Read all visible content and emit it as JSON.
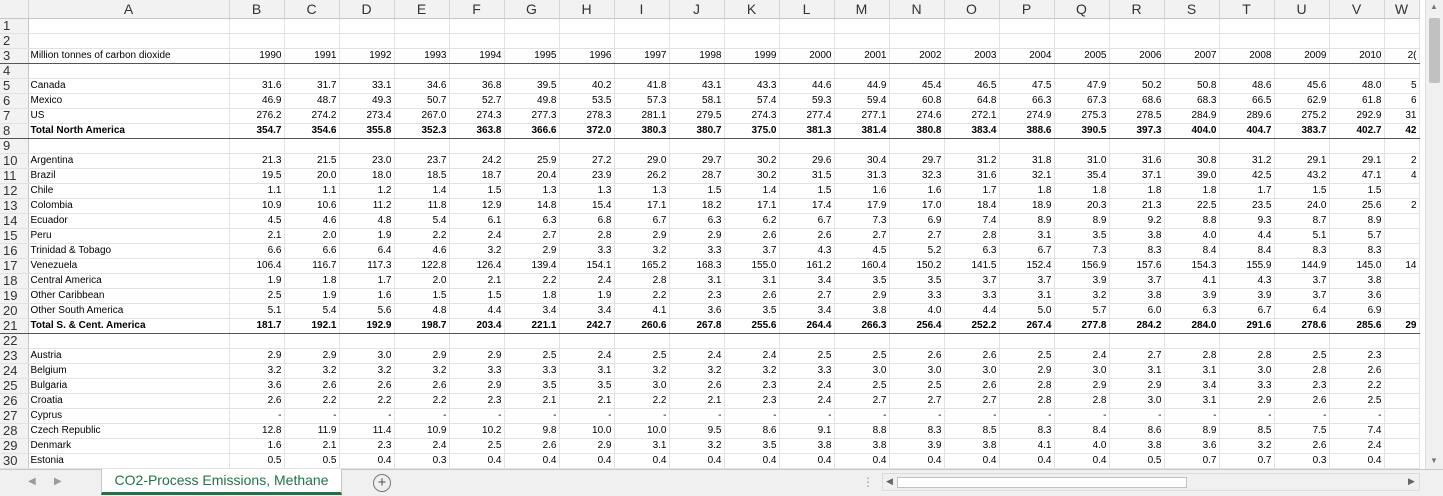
{
  "columns": [
    "A",
    "B",
    "C",
    "D",
    "E",
    "F",
    "G",
    "H",
    "I",
    "J",
    "K",
    "L",
    "M",
    "N",
    "O",
    "P",
    "Q",
    "R",
    "S",
    "T",
    "U",
    "V",
    "W"
  ],
  "rows": [
    {
      "n": "1",
      "kind": "blank",
      "label": "",
      "values": []
    },
    {
      "n": "2",
      "kind": "blank",
      "label": "",
      "values": []
    },
    {
      "n": "3",
      "kind": "hdr",
      "label": "Million tonnes of carbon dioxide",
      "values": [
        "1990",
        "1991",
        "1992",
        "1993",
        "1994",
        "1995",
        "1996",
        "1997",
        "1998",
        "1999",
        "2000",
        "2001",
        "2002",
        "2003",
        "2004",
        "2005",
        "2006",
        "2007",
        "2008",
        "2009",
        "2010",
        "2("
      ]
    },
    {
      "n": "4",
      "kind": "blank",
      "label": "",
      "values": []
    },
    {
      "n": "5",
      "kind": "data",
      "label": "Canada",
      "values": [
        "31.6",
        "31.7",
        "33.1",
        "34.6",
        "36.8",
        "39.5",
        "40.2",
        "41.8",
        "43.1",
        "43.3",
        "44.6",
        "44.9",
        "45.4",
        "46.5",
        "47.5",
        "47.9",
        "50.2",
        "50.8",
        "48.6",
        "45.6",
        "48.0",
        "5"
      ]
    },
    {
      "n": "6",
      "kind": "data",
      "label": "Mexico",
      "values": [
        "46.9",
        "48.7",
        "49.3",
        "50.7",
        "52.7",
        "49.8",
        "53.5",
        "57.3",
        "58.1",
        "57.4",
        "59.3",
        "59.4",
        "60.8",
        "64.8",
        "66.3",
        "67.3",
        "68.6",
        "68.3",
        "66.5",
        "62.9",
        "61.8",
        "6"
      ]
    },
    {
      "n": "7",
      "kind": "data",
      "label": "US",
      "values": [
        "276.2",
        "274.2",
        "273.4",
        "267.0",
        "274.3",
        "277.3",
        "278.3",
        "281.1",
        "279.5",
        "274.3",
        "277.4",
        "277.1",
        "274.6",
        "272.1",
        "274.9",
        "275.3",
        "278.5",
        "284.9",
        "289.6",
        "275.2",
        "292.9",
        "31"
      ]
    },
    {
      "n": "8",
      "kind": "total",
      "label": "Total North America",
      "values": [
        "354.7",
        "354.6",
        "355.8",
        "352.3",
        "363.8",
        "366.6",
        "372.0",
        "380.3",
        "380.7",
        "375.0",
        "381.3",
        "381.4",
        "380.8",
        "383.4",
        "388.6",
        "390.5",
        "397.3",
        "404.0",
        "404.7",
        "383.7",
        "402.7",
        "42"
      ]
    },
    {
      "n": "9",
      "kind": "blank",
      "label": "",
      "values": []
    },
    {
      "n": "10",
      "kind": "data",
      "label": "Argentina",
      "values": [
        "21.3",
        "21.5",
        "23.0",
        "23.7",
        "24.2",
        "25.9",
        "27.2",
        "29.0",
        "29.7",
        "30.2",
        "29.6",
        "30.4",
        "29.7",
        "31.2",
        "31.8",
        "31.0",
        "31.6",
        "30.8",
        "31.2",
        "29.1",
        "29.1",
        "2"
      ]
    },
    {
      "n": "11",
      "kind": "data",
      "label": "Brazil",
      "values": [
        "19.5",
        "20.0",
        "18.0",
        "18.5",
        "18.7",
        "20.4",
        "23.9",
        "26.2",
        "28.7",
        "30.2",
        "31.5",
        "31.3",
        "32.3",
        "31.6",
        "32.1",
        "35.4",
        "37.1",
        "39.0",
        "42.5",
        "43.2",
        "47.1",
        "4"
      ]
    },
    {
      "n": "12",
      "kind": "data",
      "label": "Chile",
      "values": [
        "1.1",
        "1.1",
        "1.2",
        "1.4",
        "1.5",
        "1.3",
        "1.3",
        "1.3",
        "1.5",
        "1.4",
        "1.5",
        "1.6",
        "1.6",
        "1.7",
        "1.8",
        "1.8",
        "1.8",
        "1.8",
        "1.7",
        "1.5",
        "1.5",
        ""
      ]
    },
    {
      "n": "13",
      "kind": "data",
      "label": "Colombia",
      "values": [
        "10.9",
        "10.6",
        "11.2",
        "11.8",
        "12.9",
        "14.8",
        "15.4",
        "17.1",
        "18.2",
        "17.1",
        "17.4",
        "17.9",
        "17.0",
        "18.4",
        "18.9",
        "20.3",
        "21.3",
        "22.5",
        "23.5",
        "24.0",
        "25.6",
        "2"
      ]
    },
    {
      "n": "14",
      "kind": "data",
      "label": "Ecuador",
      "values": [
        "4.5",
        "4.6",
        "4.8",
        "5.4",
        "6.1",
        "6.3",
        "6.8",
        "6.7",
        "6.3",
        "6.2",
        "6.7",
        "7.3",
        "6.9",
        "7.4",
        "8.9",
        "8.9",
        "9.2",
        "8.8",
        "9.3",
        "8.7",
        "8.9",
        ""
      ]
    },
    {
      "n": "15",
      "kind": "data",
      "label": "Peru",
      "values": [
        "2.1",
        "2.0",
        "1.9",
        "2.2",
        "2.4",
        "2.7",
        "2.8",
        "2.9",
        "2.9",
        "2.6",
        "2.6",
        "2.7",
        "2.7",
        "2.8",
        "3.1",
        "3.5",
        "3.8",
        "4.0",
        "4.4",
        "5.1",
        "5.7",
        ""
      ]
    },
    {
      "n": "16",
      "kind": "data",
      "label": "Trinidad & Tobago",
      "values": [
        "6.6",
        "6.6",
        "6.4",
        "4.6",
        "3.2",
        "2.9",
        "3.3",
        "3.2",
        "3.3",
        "3.7",
        "4.3",
        "4.5",
        "5.2",
        "6.3",
        "6.7",
        "7.3",
        "8.3",
        "8.4",
        "8.4",
        "8.3",
        "8.3",
        ""
      ]
    },
    {
      "n": "17",
      "kind": "data",
      "label": "Venezuela",
      "values": [
        "106.4",
        "116.7",
        "117.3",
        "122.8",
        "126.4",
        "139.4",
        "154.1",
        "165.2",
        "168.3",
        "155.0",
        "161.2",
        "160.4",
        "150.2",
        "141.5",
        "152.4",
        "156.9",
        "157.6",
        "154.3",
        "155.9",
        "144.9",
        "145.0",
        "14"
      ]
    },
    {
      "n": "18",
      "kind": "data",
      "label": "Central America",
      "values": [
        "1.9",
        "1.8",
        "1.7",
        "2.0",
        "2.1",
        "2.2",
        "2.4",
        "2.8",
        "3.1",
        "3.1",
        "3.4",
        "3.5",
        "3.5",
        "3.7",
        "3.7",
        "3.9",
        "3.7",
        "4.1",
        "4.3",
        "3.7",
        "3.8",
        ""
      ]
    },
    {
      "n": "19",
      "kind": "data",
      "label": "Other Caribbean",
      "values": [
        "2.5",
        "1.9",
        "1.6",
        "1.5",
        "1.5",
        "1.8",
        "1.9",
        "2.2",
        "2.3",
        "2.6",
        "2.7",
        "2.9",
        "3.3",
        "3.3",
        "3.1",
        "3.2",
        "3.8",
        "3.9",
        "3.9",
        "3.7",
        "3.6",
        ""
      ]
    },
    {
      "n": "20",
      "kind": "data",
      "label": "Other South America",
      "values": [
        "5.1",
        "5.4",
        "5.6",
        "4.8",
        "4.4",
        "3.4",
        "3.4",
        "4.1",
        "3.6",
        "3.5",
        "3.4",
        "3.8",
        "4.0",
        "4.4",
        "5.0",
        "5.7",
        "6.0",
        "6.3",
        "6.7",
        "6.4",
        "6.9",
        ""
      ]
    },
    {
      "n": "21",
      "kind": "total",
      "label": "Total S. & Cent. America",
      "values": [
        "181.7",
        "192.1",
        "192.9",
        "198.7",
        "203.4",
        "221.1",
        "242.7",
        "260.6",
        "267.8",
        "255.6",
        "264.4",
        "266.3",
        "256.4",
        "252.2",
        "267.4",
        "277.8",
        "284.2",
        "284.0",
        "291.6",
        "278.6",
        "285.6",
        "29"
      ]
    },
    {
      "n": "22",
      "kind": "blank",
      "label": "",
      "values": []
    },
    {
      "n": "23",
      "kind": "data",
      "label": "Austria",
      "values": [
        "2.9",
        "2.9",
        "3.0",
        "2.9",
        "2.9",
        "2.5",
        "2.4",
        "2.5",
        "2.4",
        "2.4",
        "2.5",
        "2.5",
        "2.6",
        "2.6",
        "2.5",
        "2.4",
        "2.7",
        "2.8",
        "2.8",
        "2.5",
        "2.3",
        ""
      ]
    },
    {
      "n": "24",
      "kind": "data",
      "label": "Belgium",
      "values": [
        "3.2",
        "3.2",
        "3.2",
        "3.2",
        "3.3",
        "3.3",
        "3.1",
        "3.2",
        "3.2",
        "3.2",
        "3.3",
        "3.0",
        "3.0",
        "3.0",
        "2.9",
        "3.0",
        "3.1",
        "3.1",
        "3.0",
        "2.8",
        "2.6",
        ""
      ]
    },
    {
      "n": "25",
      "kind": "data",
      "label": "Bulgaria",
      "values": [
        "3.6",
        "2.6",
        "2.6",
        "2.6",
        "2.9",
        "3.5",
        "3.5",
        "3.0",
        "2.6",
        "2.3",
        "2.4",
        "2.5",
        "2.5",
        "2.6",
        "2.8",
        "2.9",
        "2.9",
        "3.4",
        "3.3",
        "2.3",
        "2.2",
        ""
      ]
    },
    {
      "n": "26",
      "kind": "data",
      "label": "Croatia",
      "values": [
        "2.6",
        "2.2",
        "2.2",
        "2.2",
        "2.3",
        "2.1",
        "2.1",
        "2.2",
        "2.1",
        "2.3",
        "2.4",
        "2.7",
        "2.7",
        "2.7",
        "2.8",
        "2.8",
        "3.0",
        "3.1",
        "2.9",
        "2.6",
        "2.5",
        ""
      ]
    },
    {
      "n": "27",
      "kind": "data",
      "label": "Cyprus",
      "values": [
        "-",
        "-",
        "-",
        "-",
        "-",
        "-",
        "-",
        "-",
        "-",
        "-",
        "-",
        "-",
        "-",
        "-",
        "-",
        "-",
        "-",
        "-",
        "-",
        "-",
        "-",
        ""
      ]
    },
    {
      "n": "28",
      "kind": "data",
      "label": "Czech Republic",
      "values": [
        "12.8",
        "11.9",
        "11.4",
        "10.9",
        "10.2",
        "9.8",
        "10.0",
        "10.0",
        "9.5",
        "8.6",
        "9.1",
        "8.8",
        "8.3",
        "8.5",
        "8.3",
        "8.4",
        "8.6",
        "8.9",
        "8.5",
        "7.5",
        "7.4",
        ""
      ]
    },
    {
      "n": "29",
      "kind": "data",
      "label": "Denmark",
      "values": [
        "1.6",
        "2.1",
        "2.3",
        "2.4",
        "2.5",
        "2.6",
        "2.9",
        "3.1",
        "3.2",
        "3.5",
        "3.8",
        "3.8",
        "3.9",
        "3.8",
        "4.1",
        "4.0",
        "3.8",
        "3.6",
        "3.2",
        "2.6",
        "2.4",
        ""
      ]
    },
    {
      "n": "30",
      "kind": "data",
      "label": "Estonia",
      "values": [
        "0.5",
        "0.5",
        "0.4",
        "0.3",
        "0.4",
        "0.4",
        "0.4",
        "0.4",
        "0.4",
        "0.4",
        "0.4",
        "0.4",
        "0.4",
        "0.4",
        "0.4",
        "0.4",
        "0.5",
        "0.7",
        "0.7",
        "0.3",
        "0.4",
        ""
      ]
    }
  ],
  "sheet_tab": "CO2-Process Emissions, Methane",
  "icons": {
    "add_sheet": "plus-circle-icon",
    "prev": "triangle-left-icon",
    "next": "triangle-right-icon"
  }
}
